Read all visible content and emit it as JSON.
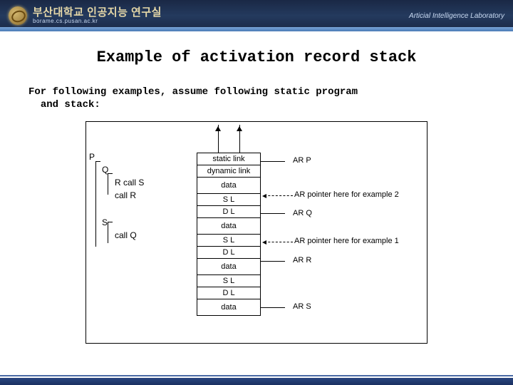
{
  "header": {
    "org_kr": "부산대학교 인공지능 연구실",
    "url": "borame.cs.pusan.ac.kr",
    "lab_en": "Articial Intelligence Laboratory"
  },
  "slide": {
    "title": "Example of activation record stack",
    "subtitle_l1": "For following examples, assume following static program",
    "subtitle_l2": "and stack:"
  },
  "prog": {
    "P": "P",
    "Q": "Q",
    "R_call_S": "R call S",
    "call_R": "call R",
    "S": "S",
    "call_Q": "call Q"
  },
  "stack": {
    "static_link": "static link",
    "dynamic_link": "dynamic link",
    "data": "data",
    "SL": "S L",
    "DL": "D L"
  },
  "annot": {
    "ar_p": "AR P",
    "ptr2": "AR pointer here for example 2",
    "ar_q": "AR Q",
    "ptr1": "AR pointer here for example 1",
    "ar_r": "AR R",
    "ar_s": "AR S"
  }
}
